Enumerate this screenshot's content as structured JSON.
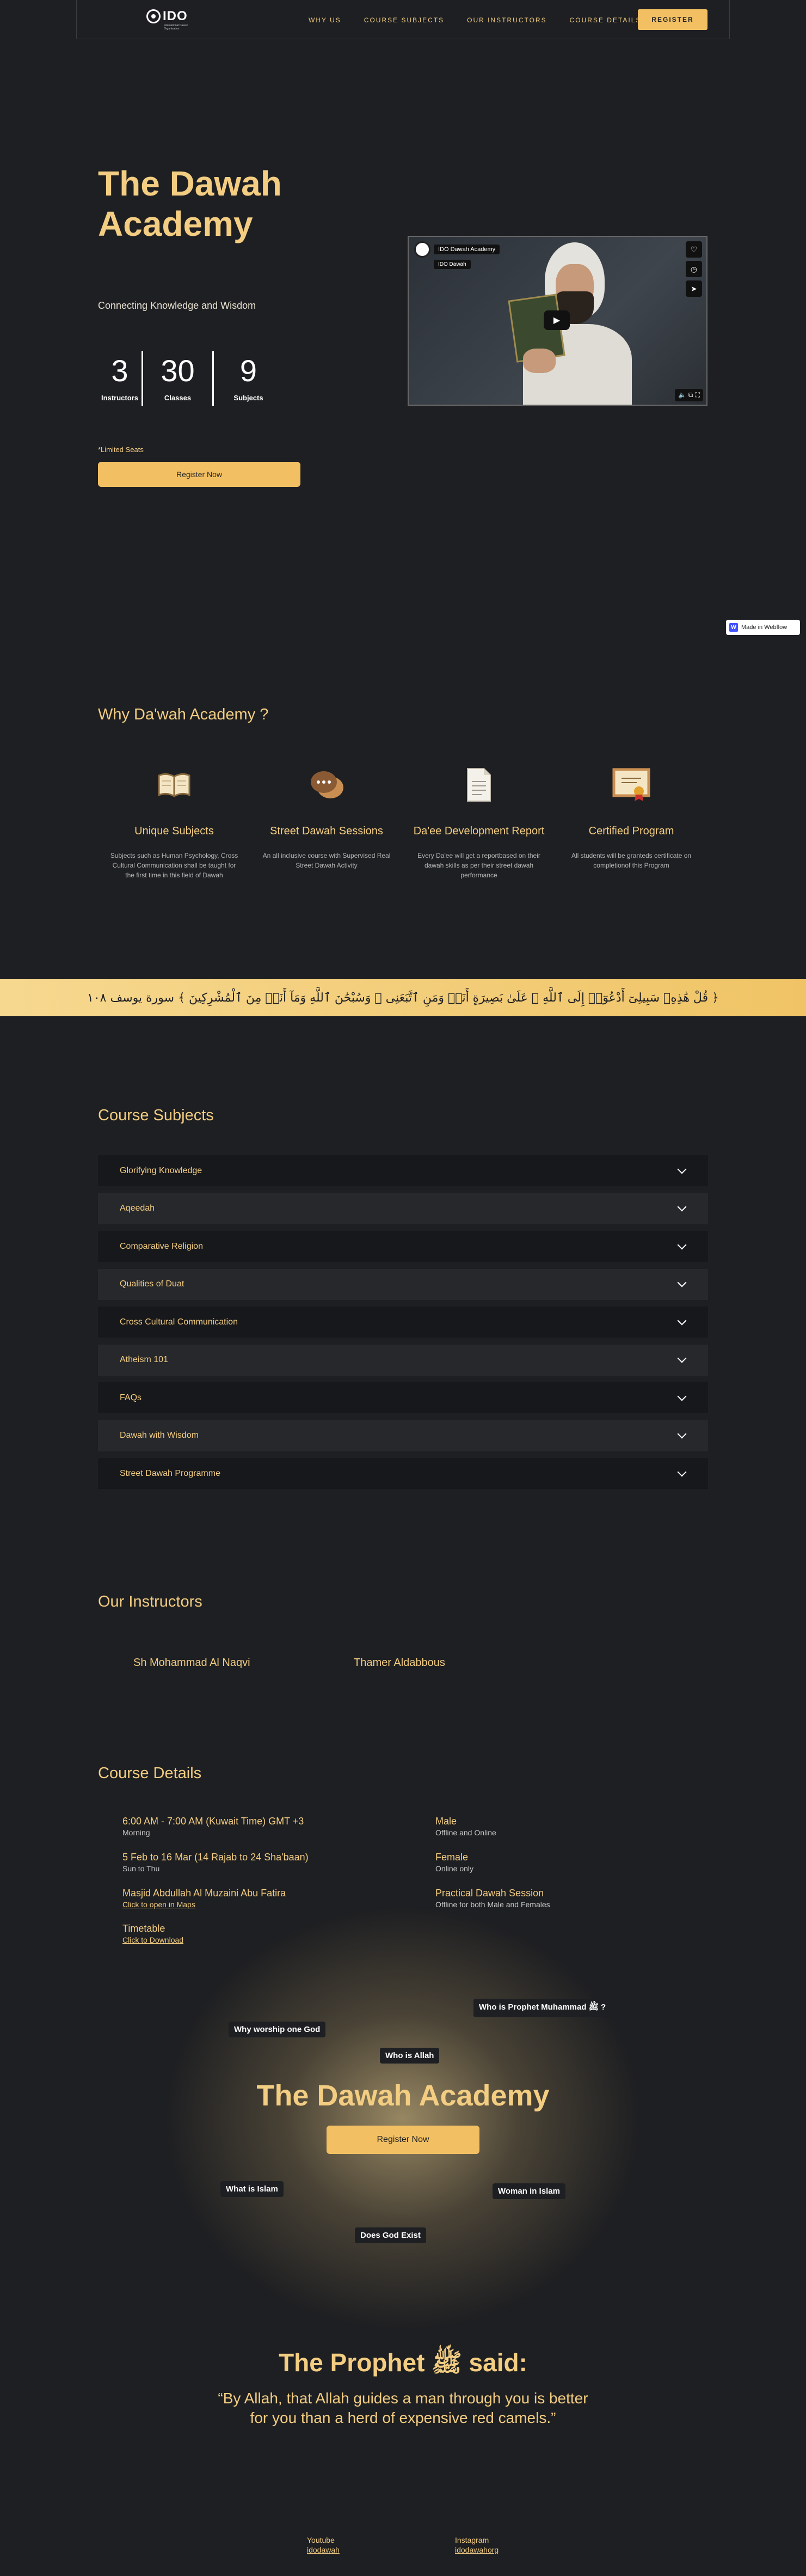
{
  "nav": {
    "logo_text": "IDO",
    "logo_sub": "International Dawah Organisation",
    "links": [
      "WHY US",
      "COURSE SUBJECTS",
      "OUR INSTRUCTORS",
      "COURSE DETAILS"
    ],
    "register": "REGISTER"
  },
  "hero": {
    "title": "The Dawah Academy",
    "subtitle": "Connecting Knowledge and Wisdom",
    "stats": [
      {
        "value": "3",
        "label": "Instructors"
      },
      {
        "value": "30",
        "label": "Classes"
      },
      {
        "value": "9",
        "label": "Subjects"
      }
    ],
    "limited": "*Limited Seats",
    "register": "Register Now"
  },
  "video": {
    "channel": "IDO Dawah Academy",
    "sub_chip": "IDO Dawah",
    "icons": [
      "heart-icon",
      "clock-icon",
      "share-icon"
    ],
    "controls": [
      "volume-icon",
      "captions-icon",
      "fullscreen-icon"
    ]
  },
  "webflow_badge": "Made in Webflow",
  "why": {
    "title": "Why Da'wah Academy ?",
    "features": [
      {
        "icon": "book-icon",
        "title": "Unique Subjects",
        "desc": "Subjects such as Human Psychology, Cross Cultural Communication shall be taught for the first time in this field of Dawah"
      },
      {
        "icon": "chat-bubble-icon",
        "title": "Street Dawah Sessions",
        "desc": "An all inclusive course with Supervised Real Street Dawah Activity"
      },
      {
        "icon": "document-icon",
        "title": "Da'ee Development Report",
        "desc": "Every Da'ee will get a reportbased on their dawah skills as per their street dawah performance"
      },
      {
        "icon": "certificate-icon",
        "title": "Certified Program",
        "desc": "All students will be granteds certificate on completionof this Program"
      }
    ]
  },
  "banner": {
    "verse": "﴿ قُلْ هَٰذِهِۦ سَبِيلِىٓ أَدْعُوٓا۟ إِلَى ٱللَّهِ ۚ عَلَىٰ بَصِيرَةٍ أَنَا۠ وَمَنِ ٱتَّبَعَنِى ۖ وَسُبْحَٰنَ ٱللَّهِ وَمَآ أَنَا۠ مِنَ ٱلْمُشْرِكِينَ ﴾ سورة يوسف ١٠٨"
  },
  "subjects": {
    "title": "Course Subjects",
    "items": [
      "Glorifying Knowledge",
      "Aqeedah",
      "Comparative Religion",
      "Qualities of Duat",
      "Cross Cultural Communication",
      "Atheism 101",
      "FAQs",
      "Dawah with Wisdom",
      "Street Dawah Programme"
    ]
  },
  "instructors": {
    "title": "Our Instructors",
    "names": [
      "Sh Mohammad Al Naqvi",
      "Thamer Aldabbous"
    ]
  },
  "details": {
    "title": "Course Details",
    "left": [
      {
        "h": "6:00 AM - 7:00 AM (Kuwait Time) GMT +3",
        "s": "Morning"
      },
      {
        "h": "5 Feb to 16 Mar (14 Rajab to 24 Sha'baan)",
        "s": "Sun to Thu"
      },
      {
        "h": "Masjid Abdullah Al Muzaini Abu Fatira",
        "link": "Click to open in Maps"
      },
      {
        "h": "Timetable",
        "link": "Click to Download"
      }
    ],
    "right": [
      {
        "h": "Male",
        "s": "Offline and Online"
      },
      {
        "h": "Female",
        "s": "Online only"
      },
      {
        "h": "Practical Dawah Session",
        "s": "Offline for both Male and Females"
      }
    ]
  },
  "cta": {
    "title": "The Dawah Academy",
    "register": "Register Now",
    "chips": [
      "Who is Prophet Muhammad ﷺ ?",
      "Why worship one God",
      "Who is Allah",
      "What is Islam",
      "Woman in Islam",
      "Does God Exist"
    ]
  },
  "prophet": {
    "title": "The Prophet ﷺ said:",
    "quote_1": "“By Allah, that Allah guides a man through you is better",
    "quote_2": "for you than a herd of  expensive red camels.”"
  },
  "footer": {
    "youtube_label": "Youtube",
    "youtube_handle": "idodawah",
    "instagram_label": "Instagram",
    "instagram_handle": "idodawahorg"
  }
}
